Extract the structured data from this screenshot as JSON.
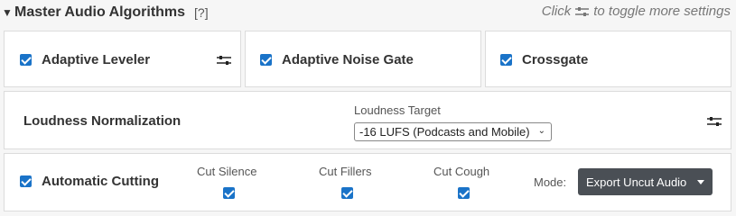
{
  "header": {
    "toggle_icon": "triangle-down-icon",
    "title": "Master Audio Algorithms",
    "help": "[?]",
    "hint_prefix": "Click",
    "hint_suffix": "to toggle more settings"
  },
  "algorithms": [
    {
      "label": "Adaptive Leveler",
      "checked": true,
      "settings_icon": "sliders-icon"
    },
    {
      "label": "Adaptive Noise Gate",
      "checked": true
    },
    {
      "label": "Crossgate",
      "checked": true
    }
  ],
  "loudness": {
    "label": "Loudness Normalization",
    "target_label": "Loudness Target",
    "target_value": "-16 LUFS (Podcasts and Mobile)"
  },
  "cutting": {
    "label": "Automatic Cutting",
    "checked": true,
    "options": [
      {
        "label": "Cut Silence",
        "checked": true
      },
      {
        "label": "Cut Fillers",
        "checked": true
      },
      {
        "label": "Cut Cough",
        "checked": true
      }
    ],
    "mode_label": "Mode:",
    "mode_value": "Export Uncut Audio"
  },
  "colors": {
    "accent": "#1a73c8",
    "button_bg": "#4a4f55",
    "panel_border": "#dcdcdc"
  }
}
